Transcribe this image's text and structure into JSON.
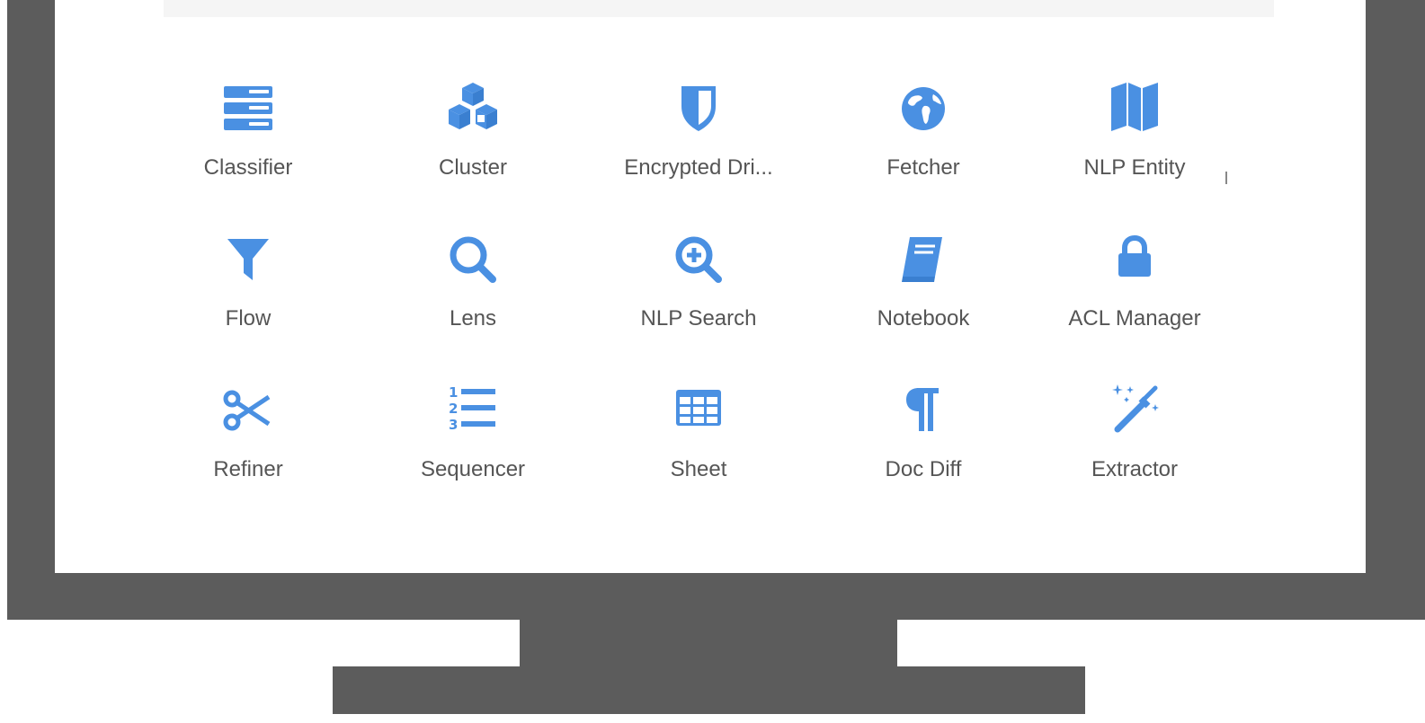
{
  "accent_color": "#4a90e2",
  "apps": [
    {
      "label": "Classifier",
      "icon": "server-stack-icon"
    },
    {
      "label": "Cluster",
      "icon": "cubes-icon"
    },
    {
      "label": "Encrypted Dri...",
      "icon": "shield-icon"
    },
    {
      "label": "Fetcher",
      "icon": "globe-icon"
    },
    {
      "label": "NLP Entity",
      "icon": "map-icon"
    },
    {
      "label": "Flow",
      "icon": "filter-icon"
    },
    {
      "label": "Lens",
      "icon": "search-icon"
    },
    {
      "label": "NLP Search",
      "icon": "zoom-in-icon"
    },
    {
      "label": "Notebook",
      "icon": "book-icon"
    },
    {
      "label": "ACL Manager",
      "icon": "lock-icon"
    },
    {
      "label": "Refiner",
      "icon": "scissors-icon"
    },
    {
      "label": "Sequencer",
      "icon": "ordered-list-icon"
    },
    {
      "label": "Sheet",
      "icon": "table-icon"
    },
    {
      "label": "Doc Diff",
      "icon": "paragraph-icon"
    },
    {
      "label": "Extractor",
      "icon": "magic-wand-icon"
    }
  ]
}
